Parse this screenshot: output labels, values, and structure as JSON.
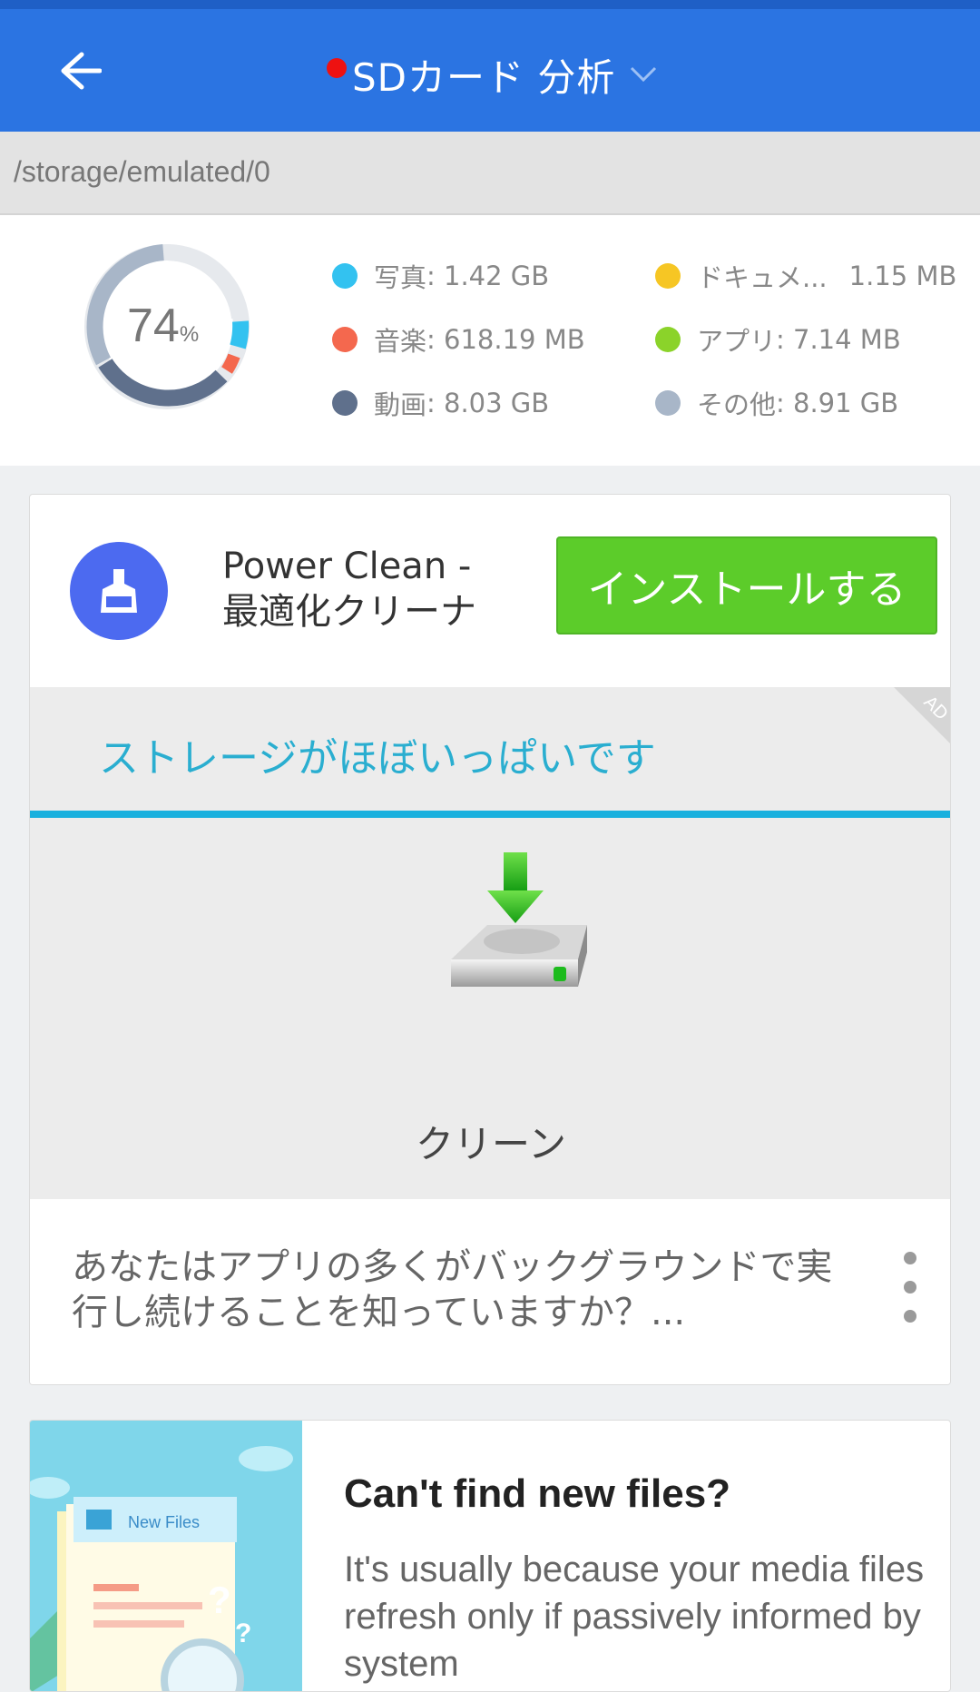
{
  "appbar": {
    "title": "SDカード 分析",
    "back_icon": "arrow-left-icon",
    "dropdown_icon": "chevron-down-icon",
    "accent": "#2b74e2"
  },
  "path": "/storage/emulated/0",
  "summary": {
    "used_percent": "74",
    "percent_sign": "%",
    "legend": [
      {
        "label": "写真",
        "value": ": 1.42 GB",
        "color": "#33c2f0"
      },
      {
        "label": "ドキュメ...",
        "value": "1.15 MB",
        "color": "#f6c624"
      },
      {
        "label": "音楽",
        "value": ": 618.19 MB",
        "color": "#f4684e"
      },
      {
        "label": "アプリ",
        "value": ": 7.14 MB",
        "color": "#8bd32a"
      },
      {
        "label": "動画",
        "value": ": 8.03 GB",
        "color": "#5f708c"
      },
      {
        "label": "その他",
        "value": ": 8.91 GB",
        "color": "#a8b6c8"
      }
    ]
  },
  "ad_card": {
    "app_name": "Power Clean -\n最適化クリーナ",
    "install_label": "インストールする",
    "ad_badge": "AD",
    "storage_message": "ストレージがほぼいっぱいです",
    "clean_label": "クリーン",
    "description": "あなたはアプリの多くがバックグラウンドで実行し続けることを知っていますか？...",
    "more_icon": "more-vertical-icon",
    "install_color": "#5ccc2a"
  },
  "tip_card": {
    "illustration_label": "New Files",
    "title": "Can't find new files?",
    "body": "It's usually because your media files refresh only if passively informed by system"
  }
}
